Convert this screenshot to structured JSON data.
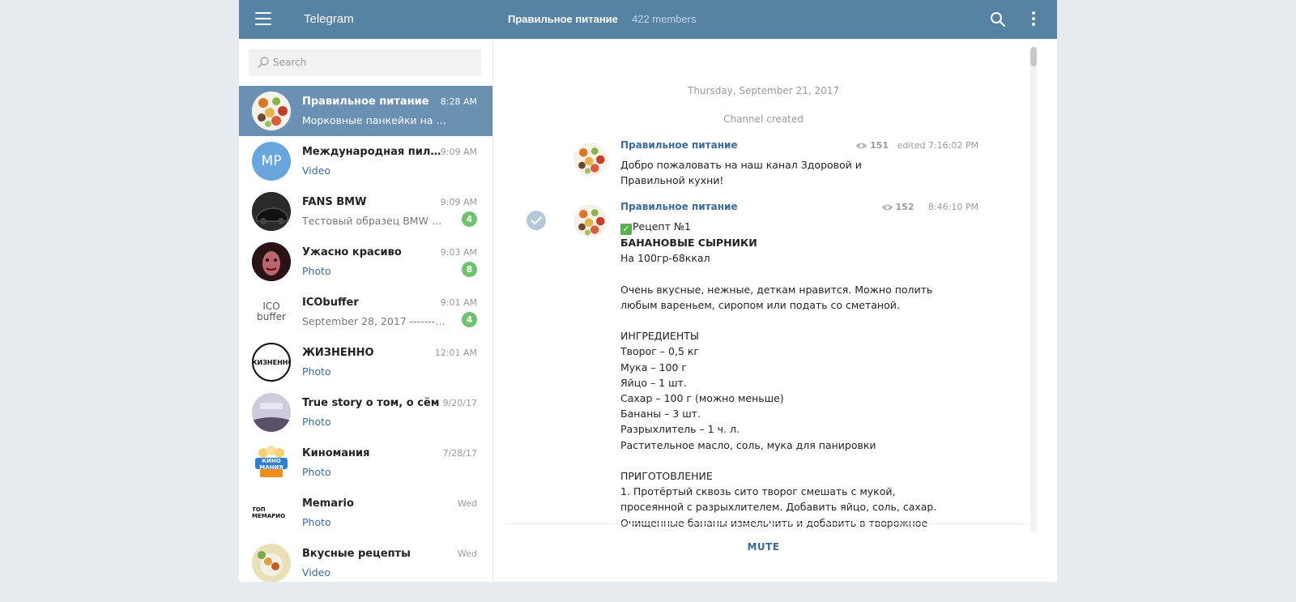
{
  "topbar": {
    "brand": "Telegram",
    "channel_title": "Правильное питание",
    "members": "422 members"
  },
  "search": {
    "placeholder": "Search"
  },
  "chats": [
    {
      "name": "Правильное питание",
      "time": "8:28 AM",
      "preview": "Морковные панкейки на 1...",
      "badge": "",
      "active": true,
      "avatar_text": ""
    },
    {
      "name": "Международная пилор...",
      "time": "9:09 AM",
      "preview": "Video",
      "badge": "",
      "avatar_text": "MP"
    },
    {
      "name": "FANS BMW",
      "time": "9:09 AM",
      "preview": "Тестовый образец BMW 7 ...",
      "badge": "4",
      "avatar_text": ""
    },
    {
      "name": "Ужасно красиво",
      "time": "9:03 AM",
      "preview": "Photo",
      "badge": "8",
      "avatar_text": ""
    },
    {
      "name": "ICObuffer",
      "time": "9:01 AM",
      "preview": "September 28, 2017 ---------...",
      "badge": "4",
      "avatar_text": "ICO buffer"
    },
    {
      "name": "ЖИЗНЕННО",
      "time": "12:01 AM",
      "preview": "Photo",
      "badge": "",
      "avatar_text": "ЖИЗНЕННО"
    },
    {
      "name": "True story о том, о сём",
      "time": "9/20/17",
      "preview": "Photo",
      "badge": "",
      "avatar_text": ""
    },
    {
      "name": "Киномания",
      "time": "7/28/17",
      "preview": "Photo",
      "badge": "",
      "avatar_text": "КИНО МАНИЯ"
    },
    {
      "name": "Memario",
      "time": "Wed",
      "preview": "Photo",
      "badge": "",
      "avatar_text": "ТОП МЕМАРИО"
    },
    {
      "name": "Вкусные рецепты",
      "time": "Wed",
      "preview": "Video",
      "badge": "",
      "avatar_text": ""
    }
  ],
  "conversation": {
    "date": "Thursday, September 21, 2017",
    "service": "Channel created",
    "messages": [
      {
        "author": "Правильное питание",
        "views": "151",
        "time": "edited 7:16:02 PM",
        "lines": [
          "Добро пожаловать на наш канал Здоровой и",
          "Правильной кухни!"
        ]
      },
      {
        "author": "Правильное питание",
        "views": "152",
        "time": "8:46:10 PM",
        "lines": [
          "Рецепт №1",
          "БАНАНОВЫЕ СЫРНИКИ",
          "На 100гр-68ккал",
          "",
          "Очень вкусные, нежные, деткам нравится. Можно полить",
          "любым вареньем, сиропом или подать со сметаной.",
          "",
          "ИНГРЕДИЕНТЫ",
          "Творог – 0,5 кг",
          "Мука – 100 г",
          "Яйцо – 1 шт.",
          "Сахар – 100 г (можно меньше)",
          "Бананы – 3 шт.",
          "Разрыхлитель – 1 ч. л.",
          "Растительное масло, соль, мука для панировки",
          "",
          "ПРИГОТОВЛЕНИЕ",
          "1. Протёртый сквозь сито творог смешать с мукой,",
          "просеянной с разрыхлителем. Добавить яйцо, соль, сахар.",
          "Очищенные бананы измельчить и добавить в творожное"
        ]
      }
    ]
  },
  "footer": {
    "mute_label": "MUTE"
  },
  "colors": {
    "header": "#5682a3",
    "active_chat": "#6a91b3",
    "badge": "#6ec26f",
    "link": "#3c6a99"
  }
}
